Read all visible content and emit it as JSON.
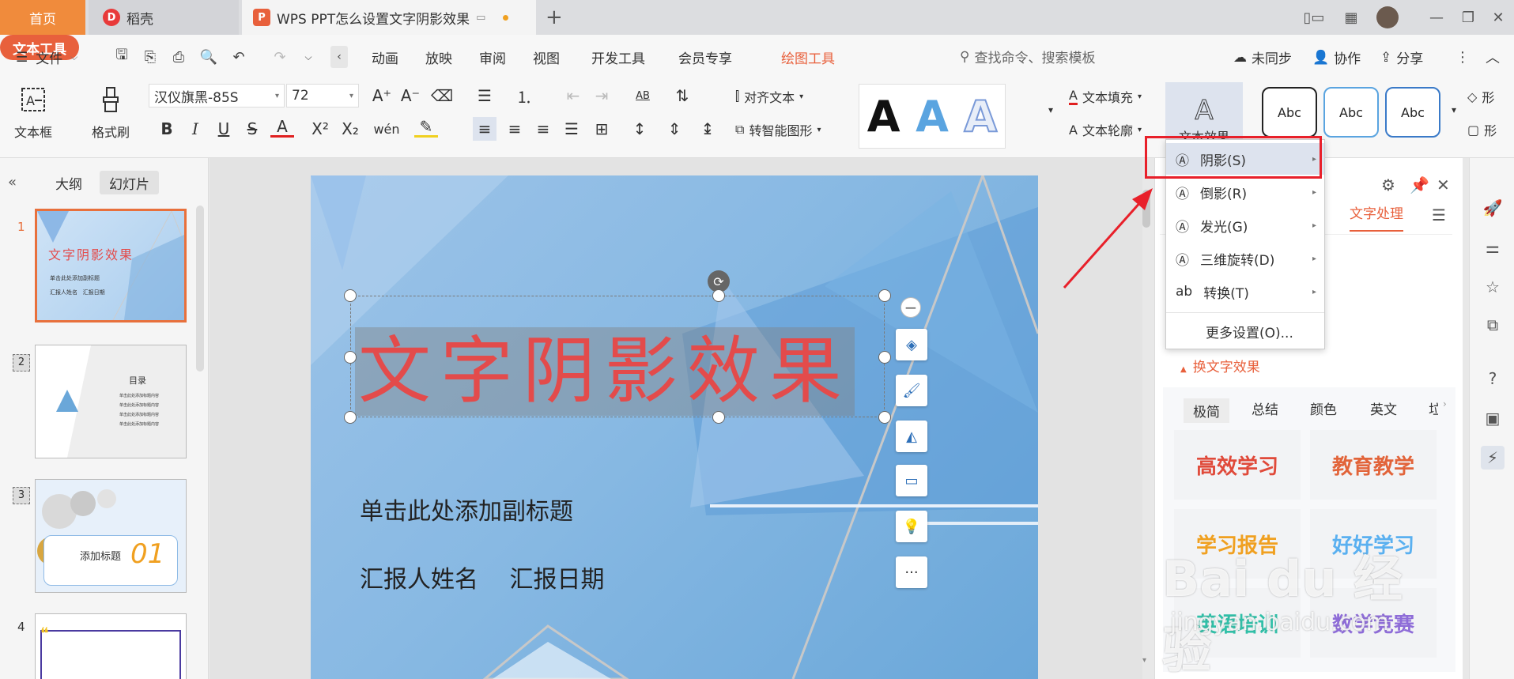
{
  "titlebar": {
    "tab_home": "首页",
    "tab_daoke": "稻壳",
    "tab_doc": "WPS PPT怎么设置文字阴影效果"
  },
  "menubar": {
    "file": "文件",
    "items": [
      "动画",
      "放映",
      "审阅",
      "视图",
      "开发工具",
      "会员专享"
    ],
    "draw_tool": "绘图工具",
    "text_tool": "文本工具",
    "search_placeholder": "查找命令、搜索模板",
    "sync": "未同步",
    "collab": "协作",
    "share": "分享"
  },
  "ribbon": {
    "textbox": "文本框",
    "format_brush": "格式刷",
    "font_name": "汉仪旗黑-85S",
    "font_size": "72",
    "align_text": "对齐文本",
    "smart_shape": "转智能图形",
    "text_fill": "文本填充",
    "text_outline": "文本轮廓",
    "text_effect": "文本效果",
    "wordart": [
      "A",
      "A",
      "A"
    ],
    "abc_styles": [
      "Abc",
      "Abc",
      "Abc"
    ],
    "fill_partial": "形",
    "outline_partial": "形",
    "colors": {
      "accent": "#e8603c",
      "wordart_blue": "#5aa4e0"
    }
  },
  "leftpanel": {
    "tab_outline": "大纲",
    "tab_slides": "幻灯片",
    "slides": [
      {
        "num": "1",
        "title": "文字阴影效果",
        "sub": "单击此处添加副标题",
        "meta": "汇报人姓名   汇报日期"
      },
      {
        "num": "2",
        "title": "目录",
        "items": [
          "单击此处添加标题内容",
          "单击此处添加标题内容",
          "单击此处添加标题内容",
          "单击此处添加标题内容"
        ]
      },
      {
        "num": "3",
        "title": "添加标题",
        "badge": "01"
      },
      {
        "num": "4"
      }
    ]
  },
  "slide": {
    "title": "文字阴影效果",
    "subtitle": "单击此处添加副标题",
    "meta": "汇报人姓名 汇报日期",
    "float_more": "···"
  },
  "dropdown": {
    "items": [
      {
        "label": "阴影(S)",
        "icon": "shadow-icon"
      },
      {
        "label": "倒影(R)",
        "icon": "reflection-icon"
      },
      {
        "label": "发光(G)",
        "icon": "glow-icon"
      },
      {
        "label": "三维旋转(D)",
        "icon": "rotate-3d-icon"
      },
      {
        "label": "转换(T)",
        "icon": "transform-icon"
      }
    ],
    "more": "更多设置(O)..."
  },
  "rightpanel": {
    "tab_text": "文字处理",
    "swap_effect": "换文字效果",
    "categories": [
      "极简",
      "总结",
      "颜色",
      "英文",
      "垃"
    ],
    "cards": [
      {
        "text": "高效学习",
        "color": "#e04a3a"
      },
      {
        "text": "教育教学",
        "color": "#e2643a"
      },
      {
        "text": "学习报告",
        "color": "#f0a020"
      },
      {
        "text": "好好学习",
        "color": "#5ab0f0"
      },
      {
        "text": "英语培训",
        "color": "#30c0a8"
      },
      {
        "text": "数学竞赛",
        "color": "#8e6cd8"
      }
    ]
  },
  "watermark": {
    "main": "Bai du 经验",
    "sub": "jingyan.baidu.com"
  }
}
